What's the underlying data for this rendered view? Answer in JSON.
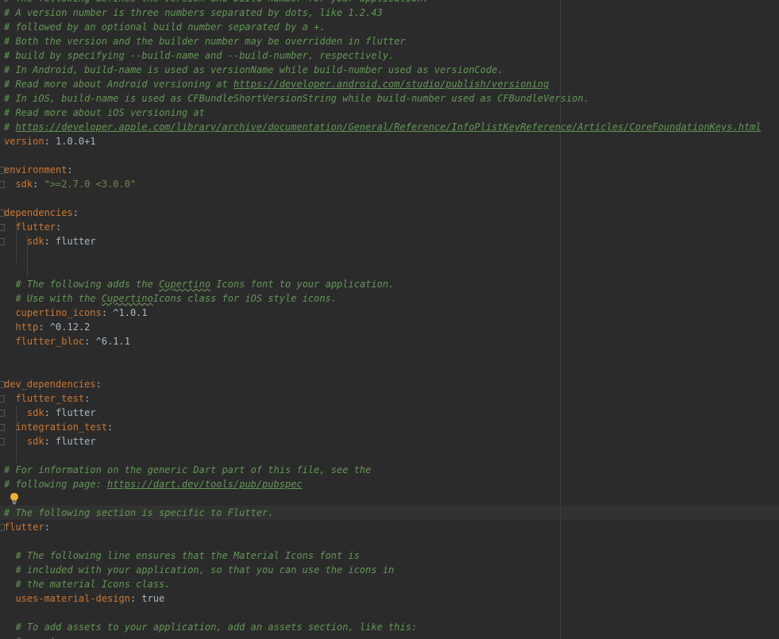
{
  "editor": {
    "lines": [
      {
        "comment": "# The following defines the version and build number for your application."
      },
      {
        "comment": "# A version number is three numbers separated by dots, like 1.2.43"
      },
      {
        "comment": "# followed by an optional build number separated by a +."
      },
      {
        "comment": "# Both the version and the builder number may be overridden in flutter"
      },
      {
        "comment": "# build by specifying --build-name and --build-number, respectively."
      },
      {
        "comment": "# In Android, build-name is used as versionName while build-number used as versionCode."
      },
      {
        "comment": "# Read more about Android versioning at ",
        "link": "https://developer.android.com/studio/publish/versioning"
      },
      {
        "comment": "# In iOS, build-name is used as CFBundleShortVersionString while build-number used as CFBundleVersion."
      },
      {
        "comment": "# Read more about iOS versioning at"
      },
      {
        "comment": "# ",
        "link": "https://developer.apple.com/library/archive/documentation/General/Reference/InfoPlistKeyReference/Articles/CoreFoundationKeys.html"
      },
      {
        "key": "version",
        "value": " 1.0.0+1"
      },
      {},
      {
        "key": "environment"
      },
      {
        "indent": "  ",
        "key": "sdk",
        "str": " \">=2.7.0 <3.0.0\""
      },
      {},
      {
        "key": "dependencies"
      },
      {
        "indent": "  ",
        "key": "flutter"
      },
      {
        "indent": "    ",
        "key": "sdk",
        "value": " flutter"
      },
      {},
      {},
      {
        "indent": "  ",
        "comment": "# The following adds the ",
        "squiggle": "Cupertino",
        "comment_tail": " Icons font to your application."
      },
      {
        "indent": "  ",
        "comment": "# Use with the ",
        "squiggle": "Cupertino",
        "comment_tail": "Icons class for iOS style icons."
      },
      {
        "indent": "  ",
        "key": "cupertino_icons",
        "value": " ^1.0.1"
      },
      {
        "indent": "  ",
        "key": "http",
        "value": " ^0.12.2"
      },
      {
        "indent": "  ",
        "key": "flutter_bloc",
        "value": " ^6.1.1"
      },
      {},
      {},
      {
        "key": "dev_dependencies"
      },
      {
        "indent": "  ",
        "key": "flutter_test"
      },
      {
        "indent": "    ",
        "key": "sdk",
        "value": " flutter"
      },
      {
        "indent": "  ",
        "key": "integration_test"
      },
      {
        "indent": "    ",
        "key": "sdk",
        "value": " flutter"
      },
      {},
      {
        "comment": "# For information on the generic Dart part of this file, see the"
      },
      {
        "comment": "# following page: ",
        "link": "https://dart.dev/tools/pub/pubspec"
      },
      {},
      {
        "comment": "# The following section is specific to Flutter."
      },
      {
        "key": "flutter"
      },
      {},
      {
        "indent": "  ",
        "comment": "# The following line ensures that the Material Icons font is"
      },
      {
        "indent": "  ",
        "comment": "# included with your application, so that you can use the icons in"
      },
      {
        "indent": "  ",
        "comment": "# the material Icons class."
      },
      {
        "indent": "  ",
        "key": "uses-material-design",
        "value": " true"
      },
      {},
      {
        "indent": "  ",
        "comment": "# To add assets to your application, add an assets section, like this:"
      },
      {
        "indent": "  ",
        "comment": "# assets:"
      }
    ],
    "current_line": 36,
    "icons": {
      "intention": "lightbulb-icon"
    },
    "colors": {
      "background": "#2b2b2b",
      "comment": "#629755",
      "key": "#cc7832",
      "string": "#6a8759",
      "text": "#a9b7c6",
      "bulb": "#f0b030"
    }
  }
}
